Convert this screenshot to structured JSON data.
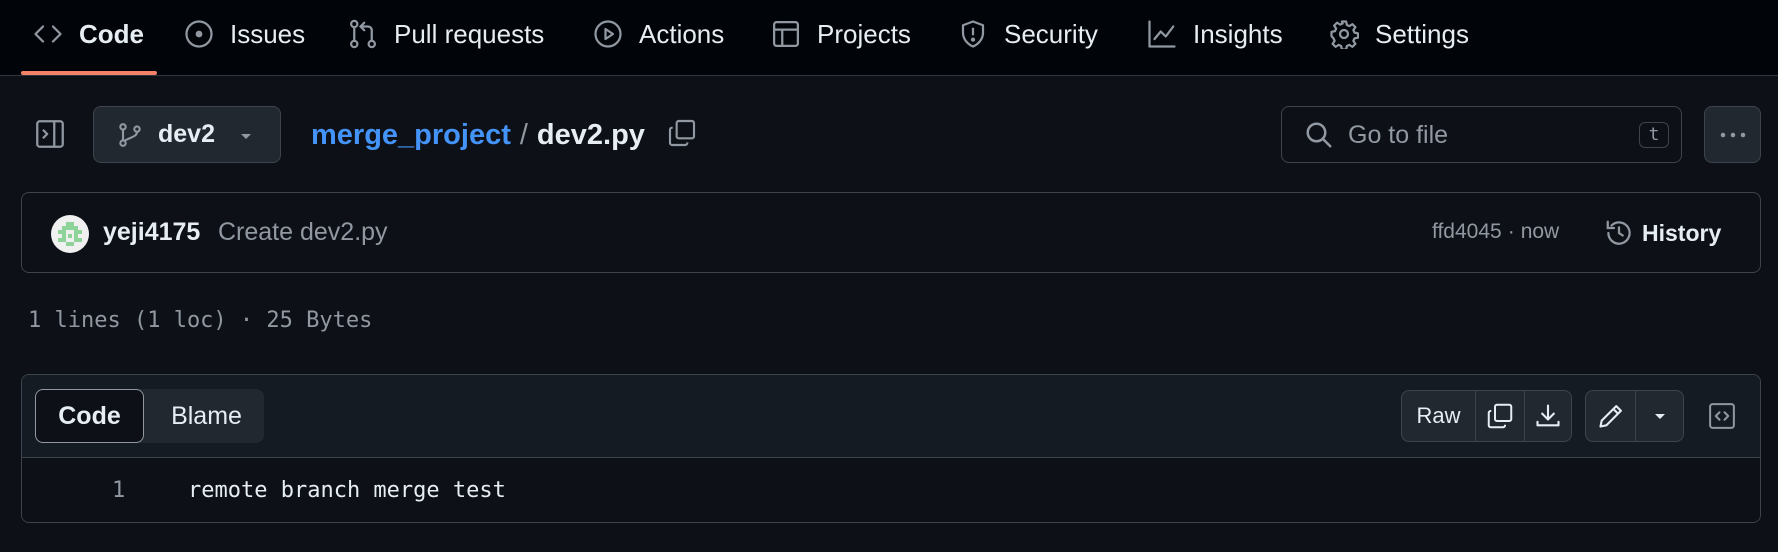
{
  "tabs": [
    {
      "label": "Code",
      "icon": "code-icon",
      "active": true
    },
    {
      "label": "Issues",
      "icon": "issue-icon"
    },
    {
      "label": "Pull requests",
      "icon": "pull-request-icon"
    },
    {
      "label": "Actions",
      "icon": "play-icon"
    },
    {
      "label": "Projects",
      "icon": "table-icon"
    },
    {
      "label": "Security",
      "icon": "shield-icon"
    },
    {
      "label": "Insights",
      "icon": "graph-icon"
    },
    {
      "label": "Settings",
      "icon": "gear-icon"
    }
  ],
  "branch": "dev2",
  "breadcrumb": {
    "repo": "merge_project",
    "separator": "/",
    "file": "dev2.py"
  },
  "search": {
    "placeholder": "Go to file",
    "shortcut": "t"
  },
  "commit": {
    "author": "yeji4175",
    "message": "Create dev2.py",
    "hash": "ffd4045",
    "dot": "·",
    "time": "now",
    "history_label": "History"
  },
  "file_meta": "1 lines (1 loc) · 25 Bytes",
  "view_tabs": {
    "code": "Code",
    "blame": "Blame"
  },
  "actions": {
    "raw": "Raw"
  },
  "code_lines": [
    {
      "number": "1",
      "text": "remote branch merge test"
    }
  ],
  "colors": {
    "accent_link": "#4493f8",
    "tab_underline": "#f78166",
    "background": "#0d1117"
  }
}
